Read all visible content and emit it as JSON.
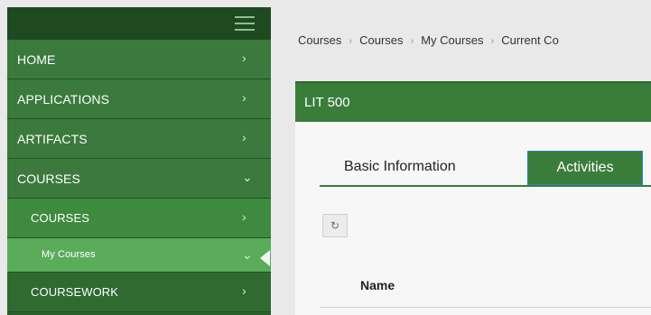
{
  "sidebar": {
    "items": [
      {
        "label": "HOME",
        "arrow": "›"
      },
      {
        "label": "APPLICATIONS",
        "arrow": "›"
      },
      {
        "label": "ARTIFACTS",
        "arrow": "›"
      },
      {
        "label": "COURSES",
        "arrow": "⌄"
      },
      {
        "label": "COURSES",
        "arrow": "›"
      },
      {
        "label": "My Courses",
        "arrow": "⌄"
      },
      {
        "label": "COURSEWORK",
        "arrow": "›"
      }
    ]
  },
  "breadcrumb": {
    "items": [
      "Courses",
      "Courses",
      "My Courses",
      "Current Co"
    ],
    "separator": "›"
  },
  "card": {
    "title": "LIT 500"
  },
  "tabs": {
    "basic": "Basic Information",
    "activities": "Activities"
  },
  "table": {
    "columns": [
      "Name"
    ]
  },
  "icons": {
    "refresh": "↻"
  },
  "colors": {
    "sidebar_dark": "#1f4a20",
    "sidebar": "#2c5f2d",
    "accent_green": "#3a7d3b",
    "active_item": "#5aac5b"
  }
}
